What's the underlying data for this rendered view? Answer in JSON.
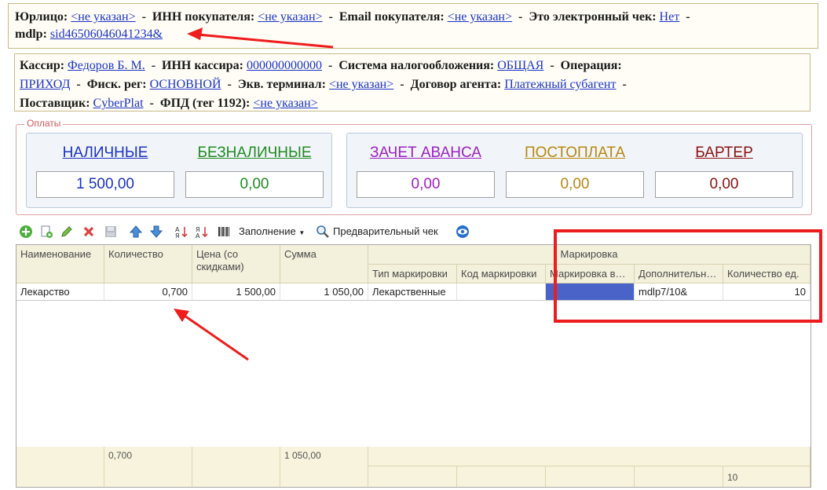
{
  "header1": {
    "legal_label": "Юрлицо:",
    "legal_value": "<не указан>",
    "inn_buyer_label": "ИНН покупателя:",
    "inn_buyer_value": "<не указан>",
    "email_label": "Email покупателя:",
    "email_value": "<не указан>",
    "electronic_label": "Это электронный чек:",
    "electronic_value": "Нет",
    "mdlp_label": "mdlp:",
    "mdlp_value": "sid46506046041234&",
    "separator": "-"
  },
  "header2": {
    "cashier_label": "Кассир:",
    "cashier_value": "Федоров Б. М.",
    "cashier_inn_label": "ИНН кассира:",
    "cashier_inn_value": "000000000000",
    "tax_label": "Система налогообложения:",
    "tax_value": "ОБЩАЯ",
    "operation_label": "Операция:",
    "operation_value": "ПРИХОД",
    "fiscal_label": "Фиск. рег:",
    "fiscal_value": "ОСНОВНОЙ",
    "terminal_label": "Экв. терминал:",
    "terminal_value": "<не указан>",
    "agent_label": "Договор агента:",
    "agent_value": "Платежный субагент",
    "supplier_label": "Поставщик:",
    "supplier_value": "CyberPlat",
    "fpd_label": "ФПД (тег 1192):",
    "fpd_value": "<не указан>"
  },
  "payments": {
    "legend": "Оплаты",
    "items": [
      {
        "title": "НАЛИЧНЫЕ",
        "value": "1 500,00",
        "color": "#1a32c4"
      },
      {
        "title": "БЕЗНАЛИЧНЫЕ",
        "value": "0,00",
        "color": "#1f8a1f"
      },
      {
        "title": "ЗАЧЕТ АВАНСА",
        "value": "0,00",
        "color": "#9b20c0"
      },
      {
        "title": "ПОСТОПЛАТА",
        "value": "0,00",
        "color": "#b8860b"
      },
      {
        "title": "БАРТЕР",
        "value": "0,00",
        "color": "#8b1010"
      }
    ]
  },
  "toolbar": {
    "fill_label": "Заполнение",
    "preview_label": "Предварительный чек",
    "icons": [
      "add-icon",
      "copy-icon",
      "edit-icon",
      "delete-icon",
      "save-icon",
      "move-up-icon",
      "move-down-icon",
      "sort-asc-icon",
      "sort-desc-icon",
      "barcode-icon",
      "magnifier-icon",
      "eye-icon"
    ]
  },
  "table": {
    "columns": {
      "name": "Наименование",
      "quantity": "Количество",
      "price": "Цена (со скидками)",
      "sum": "Сумма",
      "marking_group": "Маркировка",
      "mark_type": "Тип маркировки",
      "mark_code": "Код маркировки",
      "mark_entered": "Маркировка введена",
      "additional": "Дополнительные",
      "qty_units": "Количество ед."
    },
    "rows": [
      {
        "name": "Лекарство",
        "quantity": "0,700",
        "price": "1 500,00",
        "sum": "1 050,00",
        "mark_type": "Лекарственные",
        "mark_code": "",
        "mark_entered": "",
        "additional": "mdlp7/10&",
        "qty_units": "10"
      }
    ],
    "footer": {
      "quantity_total": "0,700",
      "sum_total": "1 050,00",
      "qty_units_total": "10"
    },
    "selected_cell_color": "#4a63c8"
  },
  "annotation_color": "#ee1c1c"
}
